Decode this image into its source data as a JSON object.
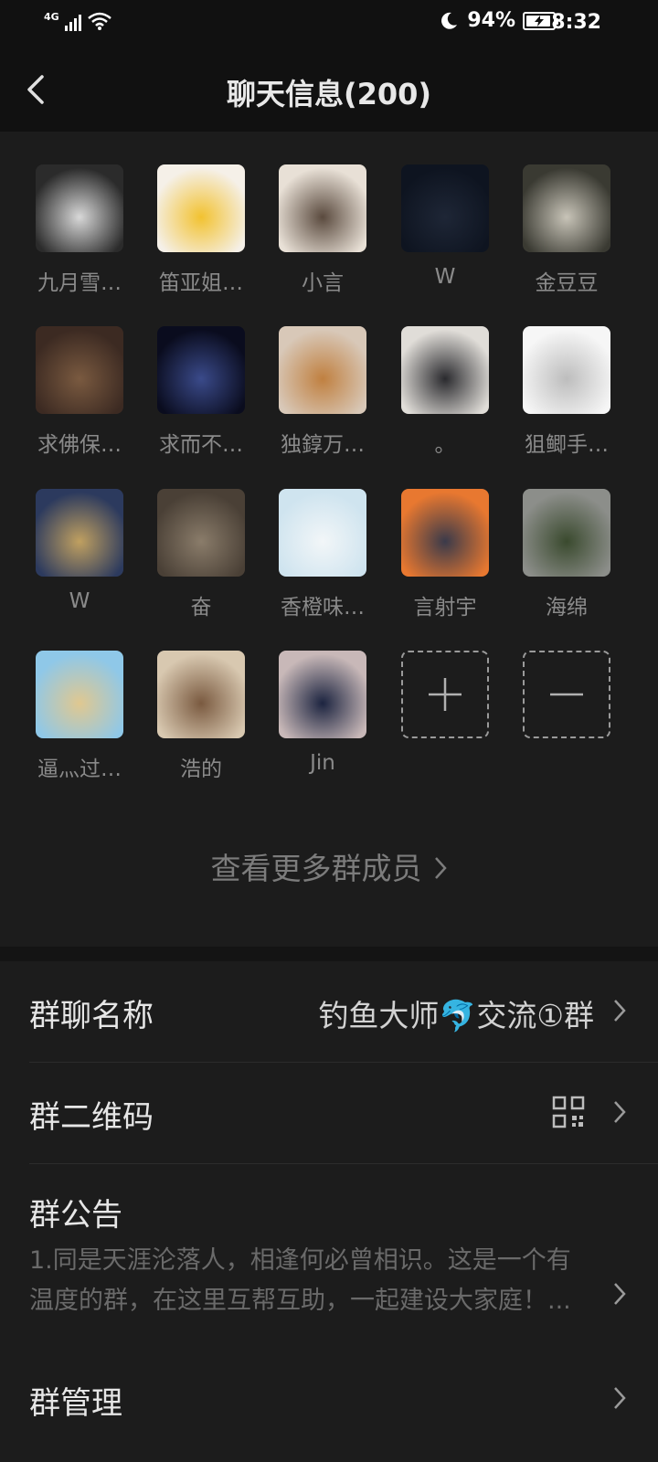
{
  "status_bar": {
    "network": "4G",
    "battery_percent": "94%",
    "battery_level": 0.94,
    "time": "8:32",
    "icons": [
      "signal-icon",
      "wifi-icon",
      "moon-icon",
      "battery-charging-icon"
    ]
  },
  "nav": {
    "title": "聊天信息(200)",
    "back_icon": "back-chevron-icon"
  },
  "members": [
    {
      "name": "九月雪…",
      "avatar_colors": [
        "#2b2b2b",
        "#d8d8d8"
      ]
    },
    {
      "name": "笛亚姐…",
      "avatar_colors": [
        "#f5f0e8",
        "#f2c230"
      ]
    },
    {
      "name": "小言",
      "avatar_colors": [
        "#e8e0d6",
        "#5a4a3e"
      ]
    },
    {
      "name": "W",
      "avatar_colors": [
        "#0e1420",
        "#1e2636"
      ]
    },
    {
      "name": "金豆豆",
      "avatar_colors": [
        "#3a3a32",
        "#c8c4b8"
      ]
    },
    {
      "name": "求佛保…",
      "avatar_colors": [
        "#3c2a22",
        "#7a5a40"
      ]
    },
    {
      "name": "求而不…",
      "avatar_colors": [
        "#0a0c1e",
        "#3a4a8a"
      ]
    },
    {
      "name": "独錞万…",
      "avatar_colors": [
        "#d8c8b8",
        "#c08040"
      ]
    },
    {
      "name": "。",
      "avatar_colors": [
        "#e0ddd8",
        "#2a2a2e"
      ]
    },
    {
      "name": "狙鲫手…",
      "avatar_colors": [
        "#f6f6f6",
        "#bdbdbd"
      ]
    },
    {
      "name": "W",
      "avatar_colors": [
        "#2c3a5e",
        "#c0a060"
      ]
    },
    {
      "name": "奋",
      "avatar_colors": [
        "#4a4036",
        "#8a7c6a"
      ]
    },
    {
      "name": "香橙味…",
      "avatar_colors": [
        "#cfe4ef",
        "#f2f6f8"
      ]
    },
    {
      "name": "言射宇",
      "avatar_colors": [
        "#e87830",
        "#3a3a4a"
      ]
    },
    {
      "name": "海绵",
      "avatar_colors": [
        "#8c8e8a",
        "#3a4a2e"
      ]
    },
    {
      "name": "逼灬过…",
      "avatar_colors": [
        "#8fc8e8",
        "#e0c890"
      ]
    },
    {
      "name": "浩的",
      "avatar_colors": [
        "#d8c8b0",
        "#7a5a40"
      ]
    },
    {
      "name": "Jin",
      "avatar_colors": [
        "#c8b8b8",
        "#1c2440"
      ]
    }
  ],
  "add_member_icon": "plus-icon",
  "remove_member_icon": "minus-icon",
  "more_members_label": "查看更多群成员",
  "settings": {
    "group_name_label": "群聊名称",
    "group_name_value": "钓鱼大师🐬交流①群",
    "qr_label": "群二维码",
    "qr_icon": "qr-code-icon",
    "notice_label": "群公告",
    "notice_text": "1.同是天涯沦落人，相逢何必曾相识。这是一个有温度的群，在这里互帮互助，一起建设大家庭！...",
    "manage_label": "群管理"
  }
}
